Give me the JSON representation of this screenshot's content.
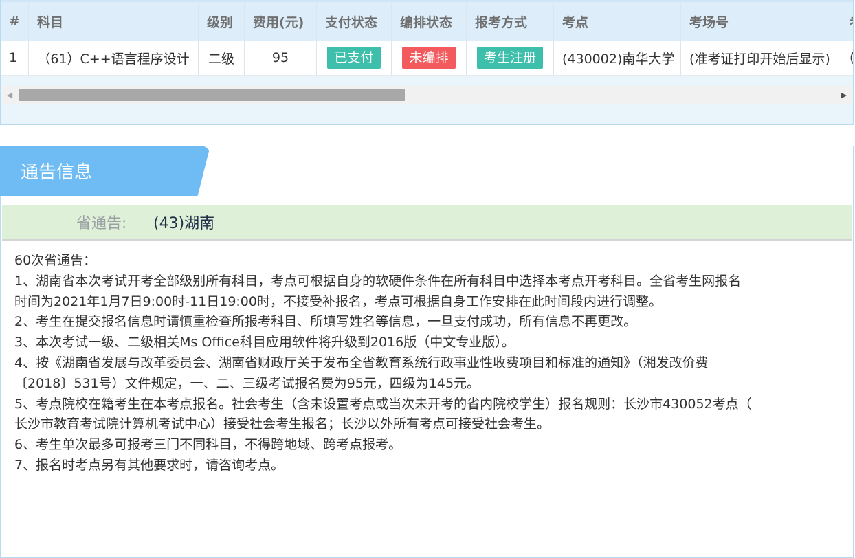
{
  "table": {
    "columns": [
      "#",
      "科目",
      "级别",
      "费用(元)",
      "支付状态",
      "编排状态",
      "报考方式",
      "考点",
      "考场号",
      "考"
    ],
    "row": {
      "index": "1",
      "subject": "（61）C++语言程序设计",
      "level": "二级",
      "fee": "95",
      "pay_status": "已支付",
      "arrange_status": "未编排",
      "apply_method": "考生注册",
      "exam_site": "(430002)南华大学",
      "exam_room": "(准考证打印开始后显示)",
      "extra": "("
    },
    "scroll": {
      "left_arrow": "◀",
      "right_arrow": "▶"
    }
  },
  "notice": {
    "tab_title": "通告信息",
    "province_label": "省通告:",
    "province_value": "(43)湖南",
    "lines": [
      "60次省通告：",
      "1、湖南省本次考试开考全部级别所有科目，考点可根据自身的软硬件条件在所有科目中选择本考点开考科目。全省考生网报名",
      "时间为2021年1月7日9:00时-11日19:00时，不接受补报名，考点可根据自身工作安排在此时间段内进行调整。",
      "2、考生在提交报名信息时请慎重检查所报考科目、所填写姓名等信息，一旦支付成功，所有信息不再更改。",
      "3、本次考试一级、二级相关Ms Office科目应用软件将升级到2016版（中文专业版）。",
      "4、按《湖南省发展与改革委员会、湖南省财政厅关于发布全省教育系统行政事业性收费项目和标准的通知》（湘发改价费",
      "〔2018〕531号）文件规定，一、二、三级考试报名费为95元，四级为145元。",
      "5、考点院校在籍考生在本考点报名。社会考生（含未设置考点或当次未开考的省内院校学生）报名规则：长沙市430052考点（",
      "长沙市教育考试院计算机考试中心）接受社会考生报名；长沙以外所有考点可接受社会考生。",
      "6、考生单次最多可报考三门不同科目，不得跨地域、跨考点报考。",
      "7、报名时考点另有其他要求时，请咨询考点。"
    ]
  },
  "colors": {
    "paid": "#3ebfac",
    "unarranged": "#f25a5e",
    "tab": "#6fbcf5",
    "province_bar": "#dff0d8"
  }
}
